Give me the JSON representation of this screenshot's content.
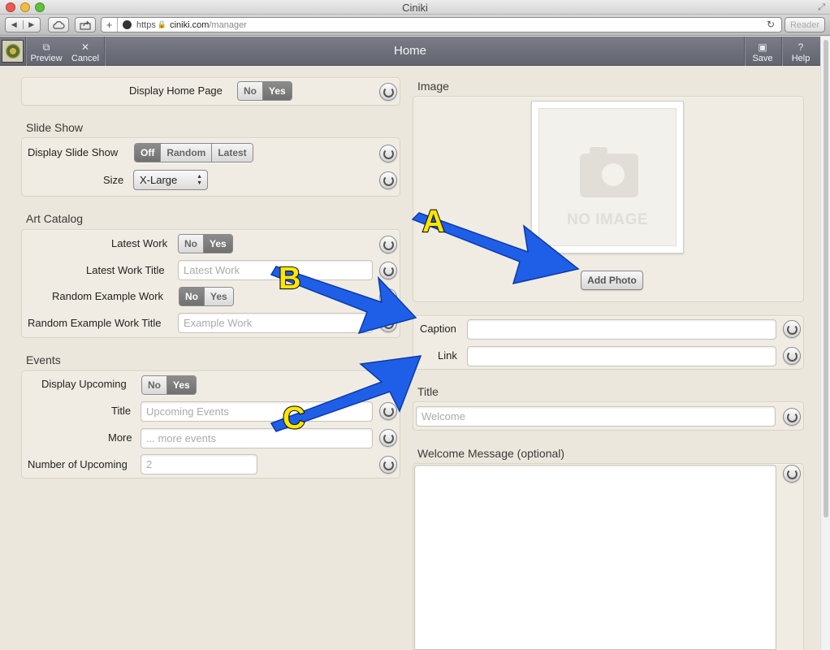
{
  "window": {
    "title": "Ciniki"
  },
  "browser": {
    "url_scheme": "https",
    "url_host": "ciniki.com",
    "url_path": "/manager",
    "reader_label": "Reader"
  },
  "header": {
    "title": "Home",
    "preview_label": "Preview",
    "cancel_label": "Cancel",
    "save_label": "Save",
    "help_label": "Help"
  },
  "home": {
    "display_home_page_label": "Display Home Page",
    "display_home_page_options": [
      "No",
      "Yes"
    ],
    "display_home_page_selected": "Yes"
  },
  "slideshow": {
    "title": "Slide Show",
    "display_label": "Display Slide Show",
    "display_options": [
      "Off",
      "Random",
      "Latest"
    ],
    "display_selected": "Off",
    "size_label": "Size",
    "size_value": "X-Large"
  },
  "art_catalog": {
    "title": "Art Catalog",
    "latest_work_label": "Latest Work",
    "latest_work_options": [
      "No",
      "Yes"
    ],
    "latest_work_selected": "Yes",
    "latest_work_title_label": "Latest Work Title",
    "latest_work_title_placeholder": "Latest Work",
    "random_example_label": "Random Example Work",
    "random_example_options": [
      "No",
      "Yes"
    ],
    "random_example_selected": "No",
    "random_example_title_label": "Random Example Work Title",
    "random_example_title_placeholder": "Example Work"
  },
  "events": {
    "title": "Events",
    "display_upcoming_label": "Display Upcoming",
    "display_upcoming_options": [
      "No",
      "Yes"
    ],
    "display_upcoming_selected": "Yes",
    "title_label": "Title",
    "title_placeholder": "Upcoming Events",
    "more_label": "More",
    "more_placeholder": "... more events",
    "number_label": "Number of Upcoming",
    "number_placeholder": "2"
  },
  "image": {
    "title": "Image",
    "no_image_text": "NO IMAGE",
    "add_photo_label": "Add Photo",
    "caption_label": "Caption",
    "link_label": "Link"
  },
  "title_section": {
    "title": "Title",
    "placeholder": "Welcome"
  },
  "welcome": {
    "title": "Welcome Message (optional)"
  },
  "annotations": {
    "letters": [
      "A",
      "B",
      "C"
    ],
    "arrow_color": "#1f5fe8",
    "badge_color": "#ffe600"
  },
  "colors": {
    "header_bg": "#6e707b",
    "page_bg": "#ece7dc",
    "segment_on": "#7c7c7c"
  }
}
